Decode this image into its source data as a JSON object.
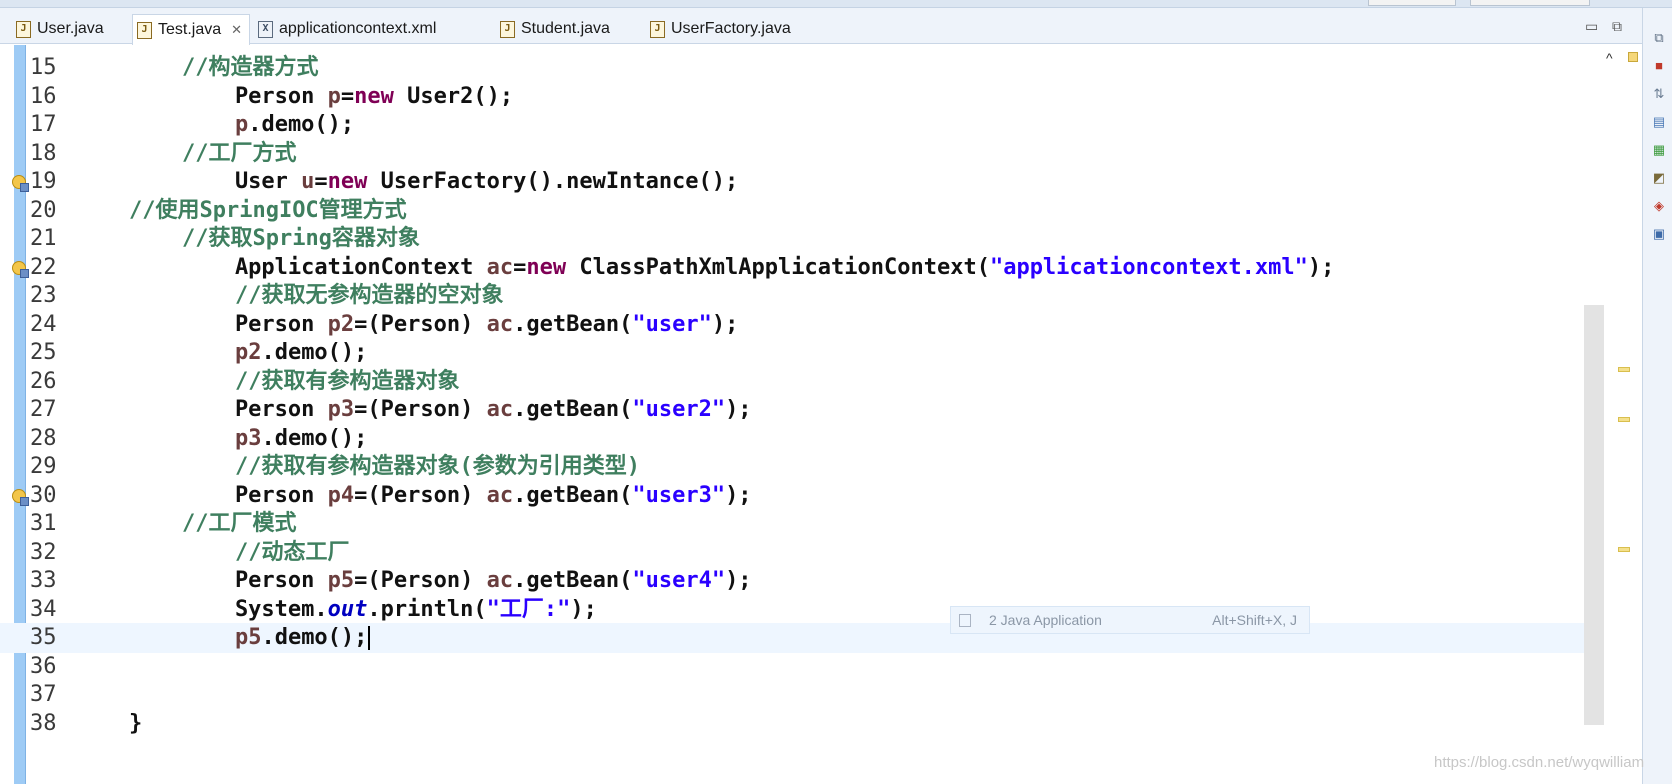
{
  "tabs": [
    {
      "label": "User.java",
      "icon": "java-file-icon"
    },
    {
      "label": "Test.java",
      "icon": "java-file-icon",
      "active": true,
      "close": "✕"
    },
    {
      "label": "applicationcontext.xml",
      "icon": "xml-file-icon"
    },
    {
      "label": "Student.java",
      "icon": "java-file-icon"
    },
    {
      "label": "UserFactory.java",
      "icon": "java-file-icon"
    }
  ],
  "window_controls": {
    "minimize": "▭",
    "maximize": "⧉"
  },
  "editor": {
    "lines": [
      {
        "num": "15",
        "segments": [
          {
            "t": "        "
          },
          {
            "t": "//构造器方式",
            "c": "cmt"
          }
        ]
      },
      {
        "num": "16",
        "segments": [
          {
            "t": "            Person "
          },
          {
            "t": "p",
            "c": "var"
          },
          {
            "t": "="
          },
          {
            "t": "new",
            "c": "kw"
          },
          {
            "t": " User2();"
          }
        ]
      },
      {
        "num": "17",
        "segments": [
          {
            "t": "            "
          },
          {
            "t": "p",
            "c": "var"
          },
          {
            "t": ".demo();"
          }
        ]
      },
      {
        "num": "18",
        "segments": [
          {
            "t": "        "
          },
          {
            "t": "//工厂方式",
            "c": "cmt"
          }
        ]
      },
      {
        "num": "19",
        "marker": true,
        "segments": [
          {
            "t": "            User "
          },
          {
            "t": "u",
            "c": "var"
          },
          {
            "t": "="
          },
          {
            "t": "new",
            "c": "kw"
          },
          {
            "t": " UserFactory().newIntance();"
          }
        ]
      },
      {
        "num": "20",
        "segments": [
          {
            "t": "    "
          },
          {
            "t": "//使用SpringIOC管理方式",
            "c": "cmt"
          }
        ]
      },
      {
        "num": "21",
        "segments": [
          {
            "t": "        "
          },
          {
            "t": "//获取Spring容器对象",
            "c": "cmt"
          }
        ]
      },
      {
        "num": "22",
        "marker": true,
        "segments": [
          {
            "t": "            ApplicationContext "
          },
          {
            "t": "ac",
            "c": "var"
          },
          {
            "t": "="
          },
          {
            "t": "new",
            "c": "kw"
          },
          {
            "t": " ClassPathXmlApplicationContext("
          },
          {
            "t": "\"applicationcontext.xml\"",
            "c": "str"
          },
          {
            "t": ");"
          }
        ]
      },
      {
        "num": "23",
        "segments": [
          {
            "t": "            "
          },
          {
            "t": "//获取无参构造器的空对象",
            "c": "cmt"
          }
        ]
      },
      {
        "num": "24",
        "segments": [
          {
            "t": "            Person "
          },
          {
            "t": "p2",
            "c": "var"
          },
          {
            "t": "=(Person) "
          },
          {
            "t": "ac",
            "c": "var"
          },
          {
            "t": ".getBean("
          },
          {
            "t": "\"user\"",
            "c": "str"
          },
          {
            "t": ");"
          }
        ]
      },
      {
        "num": "25",
        "segments": [
          {
            "t": "            "
          },
          {
            "t": "p2",
            "c": "var"
          },
          {
            "t": ".demo();"
          }
        ]
      },
      {
        "num": "26",
        "segments": [
          {
            "t": "            "
          },
          {
            "t": "//获取有参构造器对象",
            "c": "cmt"
          }
        ]
      },
      {
        "num": "27",
        "segments": [
          {
            "t": "            Person "
          },
          {
            "t": "p3",
            "c": "var"
          },
          {
            "t": "=(Person) "
          },
          {
            "t": "ac",
            "c": "var"
          },
          {
            "t": ".getBean("
          },
          {
            "t": "\"user2\"",
            "c": "str"
          },
          {
            "t": ");"
          }
        ]
      },
      {
        "num": "28",
        "segments": [
          {
            "t": "            "
          },
          {
            "t": "p3",
            "c": "var"
          },
          {
            "t": ".demo();"
          }
        ]
      },
      {
        "num": "29",
        "segments": [
          {
            "t": "            "
          },
          {
            "t": "//获取有参构造器对象(参数为引用类型)",
            "c": "cmt"
          }
        ]
      },
      {
        "num": "30",
        "marker": true,
        "segments": [
          {
            "t": "            Person "
          },
          {
            "t": "p4",
            "c": "var"
          },
          {
            "t": "=(Person) "
          },
          {
            "t": "ac",
            "c": "var"
          },
          {
            "t": ".getBean("
          },
          {
            "t": "\"user3\"",
            "c": "str"
          },
          {
            "t": ");"
          }
        ]
      },
      {
        "num": "31",
        "segments": [
          {
            "t": "        "
          },
          {
            "t": "//工厂模式",
            "c": "cmt"
          }
        ]
      },
      {
        "num": "32",
        "segments": [
          {
            "t": "            "
          },
          {
            "t": "//动态工厂",
            "c": "cmt"
          }
        ]
      },
      {
        "num": "33",
        "segments": [
          {
            "t": "            Person "
          },
          {
            "t": "p5",
            "c": "var"
          },
          {
            "t": "=(Person) "
          },
          {
            "t": "ac",
            "c": "var"
          },
          {
            "t": ".getBean("
          },
          {
            "t": "\"user4\"",
            "c": "str"
          },
          {
            "t": ");"
          }
        ]
      },
      {
        "num": "34",
        "segments": [
          {
            "t": "            System."
          },
          {
            "t": "out",
            "c": "fld"
          },
          {
            "t": ".println("
          },
          {
            "t": "\"工厂:\"",
            "c": "str"
          },
          {
            "t": ");"
          }
        ]
      },
      {
        "num": "35",
        "current": true,
        "cursor": true,
        "segments": [
          {
            "t": "            "
          },
          {
            "t": "p5",
            "c": "var"
          },
          {
            "t": ".demo();"
          }
        ]
      },
      {
        "num": "36",
        "segments": []
      },
      {
        "num": "37",
        "segments": []
      },
      {
        "num": "38",
        "segments": [
          {
            "t": "    }"
          }
        ]
      }
    ]
  },
  "popup": {
    "label": "2 Java Application",
    "shortcut": "Alt+Shift+X, J"
  },
  "collapse_glyph": "^",
  "watermark": "https://blog.csdn.net/wyqwilliam",
  "colors": {
    "keyword": "#7f0055",
    "string": "#2a00ff",
    "comment": "#3f7f5f",
    "gutter": "#9ecbf5"
  }
}
